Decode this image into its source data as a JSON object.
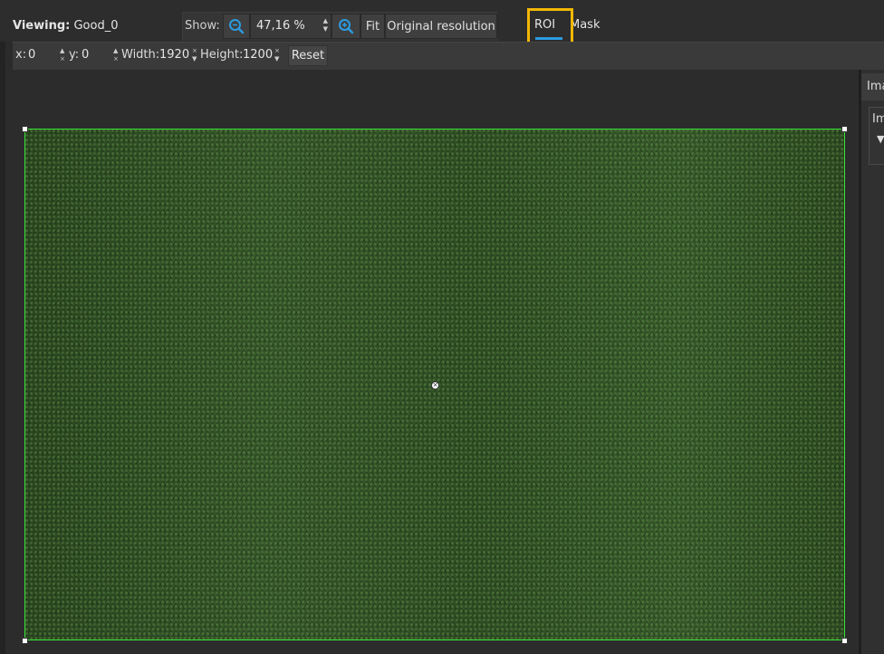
{
  "viewing": {
    "label": "Viewing:",
    "name": "Good_0"
  },
  "show": {
    "label": "Show:",
    "zoom_value": "47,16 %",
    "fit_label": "Fit",
    "original_label": "Original resolution"
  },
  "tabs": {
    "roi": "ROI",
    "mask": "Mask",
    "active": "ROI"
  },
  "roi": {
    "x_label": "x:",
    "x_value": "0",
    "y_label": "y:",
    "y_value": "0",
    "width_label": "Width:",
    "width_value": "1920",
    "height_label": "Height:",
    "height_value": "1200",
    "reset_label": "Reset"
  },
  "right_panel": {
    "header": "Ima",
    "box_label": "Im"
  },
  "icons": {
    "zoom_out": "zoom-out-icon",
    "zoom_in": "zoom-in-icon",
    "spin_up": "▲",
    "spin_down": "▼",
    "clear": "×"
  },
  "colors": {
    "accent": "#2b9be0",
    "highlight": "#f2b705",
    "roi_border": "#39e639",
    "image_fill": "#2f4f23"
  }
}
